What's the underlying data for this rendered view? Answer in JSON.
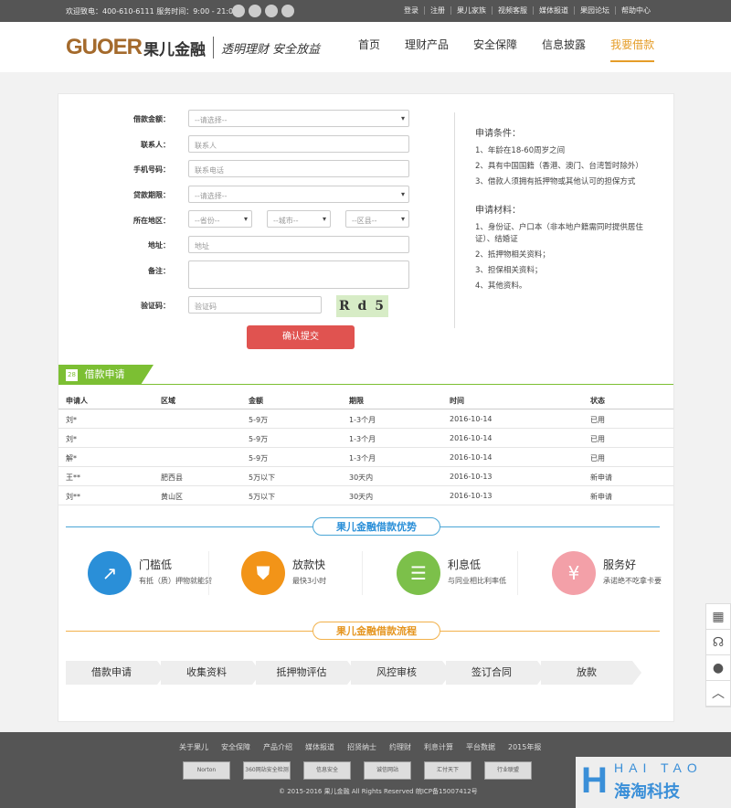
{
  "topbar": {
    "welcome": "欢迎致电：400-610-6111 服务时间：9:00 - 21:00",
    "links": [
      "登录",
      "注册",
      "果儿家族",
      "视频客服",
      "媒体报道",
      "果园论坛",
      "帮助中心"
    ]
  },
  "header": {
    "logo_en": "GUOER",
    "logo_cn": "果儿金融",
    "slogan": "透明理财 安全放益",
    "nav": [
      "首页",
      "理财产品",
      "安全保障",
      "信息披露",
      "我要借款"
    ],
    "active_nav": "我要借款"
  },
  "form": {
    "amount_label": "借款金额：",
    "amount_value": "--请选择--",
    "contact_label": "联系人：",
    "contact_placeholder": "联系人",
    "phone_label": "手机号码：",
    "phone_placeholder": "联系电话",
    "term_label": "贷款期限：",
    "term_value": "--请选择--",
    "region_label": "所在地区：",
    "province": "--省份--",
    "city": "--城市--",
    "district": "--区县--",
    "address_label": "地址：",
    "address_placeholder": "地址",
    "note_label": "备注：",
    "captcha_label": "验证码：",
    "captcha_placeholder": "验证码",
    "captcha_text": "R d 5",
    "submit": "确认提交"
  },
  "conditions": {
    "title": "申请条件：",
    "items": [
      "1、年龄在18-60周岁之间",
      "2、具有中国国籍（香港、澳门、台湾暂时除外）",
      "3、借款人须拥有抵押物或其他认可的担保方式"
    ],
    "materials_title": "申请材料：",
    "materials": [
      "1、身份证、户口本（非本地户籍需同时提供居住证）、结婚证",
      "2、抵押物相关资料；",
      "3、担保相关资料；",
      "4、其他资料。"
    ]
  },
  "applications": {
    "tag_num": "28",
    "title": "借款申请",
    "headers": [
      "申请人",
      "区域",
      "金额",
      "期限",
      "时间",
      "状态"
    ],
    "rows": [
      [
        "刘*",
        "",
        "5-9万",
        "1-3个月",
        "2016-10-14",
        "已用"
      ],
      [
        "刘*",
        "",
        "5-9万",
        "1-3个月",
        "2016-10-14",
        "已用"
      ],
      [
        "解*",
        "",
        "5-9万",
        "1-3个月",
        "2016-10-14",
        "已用"
      ],
      [
        "王**",
        "肥西县",
        "5万以下",
        "30天内",
        "2016-10-13",
        "新申请"
      ],
      [
        "刘**",
        "黄山区",
        "5万以下",
        "30天内",
        "2016-10-13",
        "新申请"
      ]
    ]
  },
  "advantages": {
    "title": "果儿金融借款优势",
    "items": [
      {
        "title": "门槛低",
        "desc": "有抵（质）押物就能贷",
        "color": "#2a8fd8",
        "icon": "chart-up-icon",
        "glyph": "↗"
      },
      {
        "title": "放款快",
        "desc": "最快3小时",
        "color": "#f29418",
        "icon": "shield-icon",
        "glyph": "⛊"
      },
      {
        "title": "利息低",
        "desc": "与同业相比利率低",
        "color": "#7cc04a",
        "icon": "document-icon",
        "glyph": "☰"
      },
      {
        "title": "服务好",
        "desc": "承诺绝不吃拿卡要",
        "color": "#f3a0a8",
        "icon": "yen-icon",
        "glyph": "¥"
      }
    ]
  },
  "process": {
    "title": "果儿金融借款流程",
    "steps": [
      "借款申请",
      "收集资料",
      "抵押物评估",
      "风控审核",
      "签订合同",
      "放款"
    ]
  },
  "footer": {
    "links": [
      "关于果儿",
      "安全保障",
      "产品介绍",
      "媒体报道",
      "招贤纳士",
      "约理财",
      "利息计算",
      "平台数据",
      "2015年报"
    ],
    "badges": [
      "Norton",
      "360网站安全检测",
      "信息安全",
      "诚信网站",
      "汇付天下",
      "行业联盟"
    ],
    "copyright": "© 2015-2016 果儿金融 All Rights Reserved 皖ICP备15007412号"
  },
  "watermark": {
    "letter": "H",
    "en": "HAI TAO",
    "cn": "海淘科技"
  },
  "sidebar": [
    "calculator-icon",
    "headset-icon",
    "qq-icon",
    "back-to-top-icon"
  ]
}
